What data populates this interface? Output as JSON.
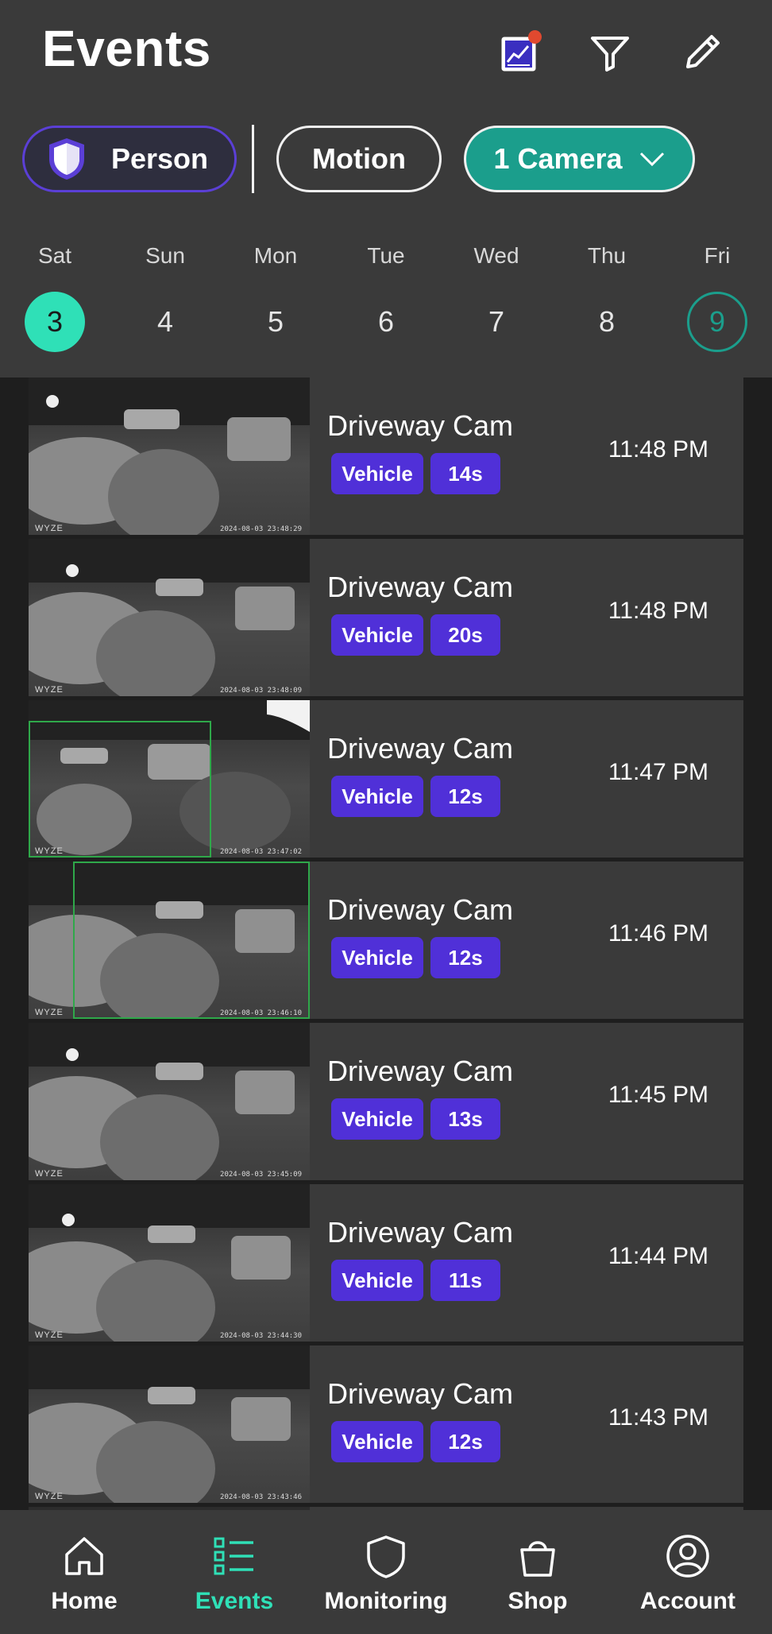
{
  "header": {
    "title": "Events"
  },
  "icons": {
    "insights": "chart-icon",
    "filter": "filter-icon",
    "edit": "pencil-icon"
  },
  "filters": {
    "person": "Person",
    "motion": "Motion",
    "camera": "1 Camera"
  },
  "week": [
    {
      "name": "Sat",
      "num": "3"
    },
    {
      "name": "Sun",
      "num": "4"
    },
    {
      "name": "Mon",
      "num": "5"
    },
    {
      "name": "Tue",
      "num": "6"
    },
    {
      "name": "Wed",
      "num": "7"
    },
    {
      "name": "Thu",
      "num": "8"
    },
    {
      "name": "Fri",
      "num": "9"
    }
  ],
  "events": [
    {
      "camera": "Driveway Cam",
      "type": "Vehicle",
      "duration": "14s",
      "time": "11:48 PM",
      "stamp": "2024-08-03 23:48:29"
    },
    {
      "camera": "Driveway Cam",
      "type": "Vehicle",
      "duration": "20s",
      "time": "11:48 PM",
      "stamp": "2024-08-03 23:48:09"
    },
    {
      "camera": "Driveway Cam",
      "type": "Vehicle",
      "duration": "12s",
      "time": "11:47 PM",
      "stamp": "2024-08-03 23:47:02"
    },
    {
      "camera": "Driveway Cam",
      "type": "Vehicle",
      "duration": "12s",
      "time": "11:46 PM",
      "stamp": "2024-08-03 23:46:10"
    },
    {
      "camera": "Driveway Cam",
      "type": "Vehicle",
      "duration": "13s",
      "time": "11:45 PM",
      "stamp": "2024-08-03 23:45:09"
    },
    {
      "camera": "Driveway Cam",
      "type": "Vehicle",
      "duration": "11s",
      "time": "11:44 PM",
      "stamp": "2024-08-03 23:44:30"
    },
    {
      "camera": "Driveway Cam",
      "type": "Vehicle",
      "duration": "12s",
      "time": "11:43 PM",
      "stamp": "2024-08-03 23:43:46"
    }
  ],
  "thumb_brand": "WYZE",
  "nav": {
    "home": "Home",
    "events": "Events",
    "monitoring": "Monitoring",
    "shop": "Shop",
    "account": "Account"
  },
  "colors": {
    "accent": "#2fe0b7",
    "teal": "#1b9e8c",
    "tag": "#5030d8",
    "notify": "#e0492f"
  }
}
